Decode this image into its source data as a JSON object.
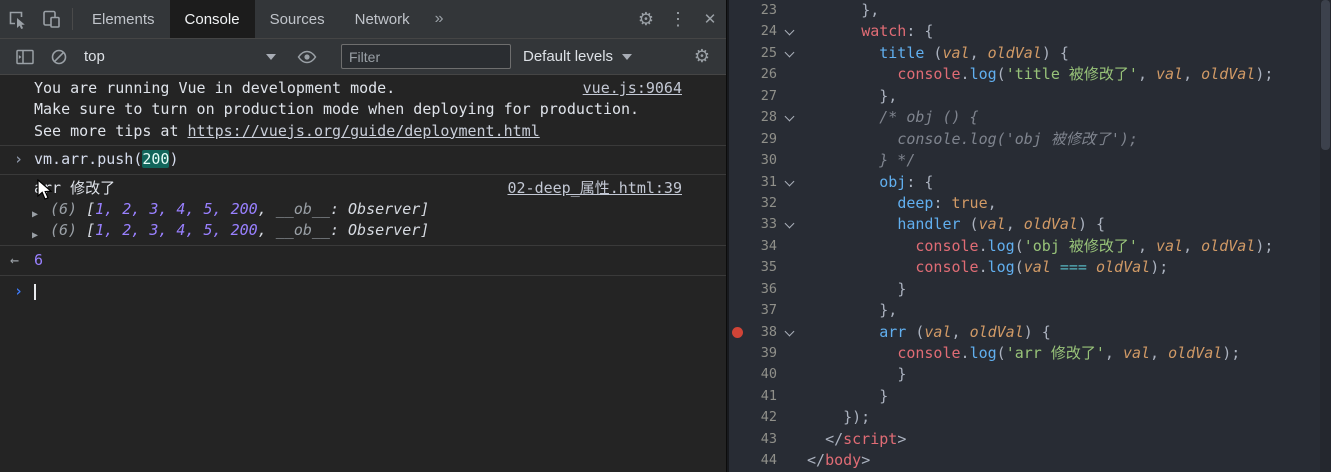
{
  "colors": {
    "toolbar_bg": "#333639",
    "console_bg": "#242424",
    "editor_bg": "#282c34",
    "breakpoint_red": "#d04437",
    "prompt_blue": "#3e7bfa",
    "number_purple": "#9980ff",
    "string_green": "#98c379",
    "func_blue": "#61afef",
    "key_red": "#e06c75",
    "param_orange": "#d19a66",
    "comment_gray": "#7f848e",
    "operator_cyan": "#56b6c2",
    "arg_highlight_teal": "#12655b"
  },
  "devtools": {
    "tabs": [
      "Elements",
      "Console",
      "Sources",
      "Network"
    ],
    "active_tab": "Console",
    "overflow": "»",
    "gear": "⚙",
    "kebab": "⋮",
    "close": "✕"
  },
  "console_toolbar": {
    "context": "top",
    "filter_placeholder": "Filter",
    "levels": "Default levels"
  },
  "console": {
    "vue_message": {
      "line1": "You are running Vue in development mode.",
      "line2": "Make sure to turn on production mode when deploying for production.",
      "line3_prefix": "See more tips at ",
      "line3_link": "https://vuejs.org/guide/deployment.html",
      "source": "vue.js:9064"
    },
    "command": {
      "chevron": "›",
      "prefix": "vm.arr.push(",
      "arg": "200",
      "suffix": ")"
    },
    "log": {
      "text": "arr 修改了",
      "source": "02-deep_属性.html:39",
      "expand_triangle": "▶",
      "array_count": "(6)",
      "array_open": "[",
      "array_numbers": "1, 2, 3, 4, 5, 200",
      "array_sep": ", ",
      "array_key": "__ob__",
      "array_colon": ": ",
      "array_class": "Observer",
      "array_close": "]"
    },
    "result_arrow": "←",
    "result": "6",
    "prompt_chevron": "›"
  },
  "editor": {
    "breakpoint_line": 38,
    "lines": [
      {
        "n": 23,
        "ind": 6,
        "t": [
          [
            "p",
            "},"
          ]
        ]
      },
      {
        "n": 24,
        "ind": 6,
        "fold": true,
        "t": [
          [
            "r",
            "watch"
          ],
          [
            "p",
            ": {"
          ]
        ]
      },
      {
        "n": 25,
        "ind": 8,
        "fold": true,
        "t": [
          [
            "f",
            "title"
          ],
          [
            "p",
            " ("
          ],
          [
            "a",
            "val"
          ],
          [
            "p",
            ", "
          ],
          [
            "a",
            "oldVal"
          ],
          [
            "p",
            ") {"
          ]
        ]
      },
      {
        "n": 26,
        "ind": 10,
        "t": [
          [
            "r",
            "console"
          ],
          [
            "p",
            "."
          ],
          [
            "f",
            "log"
          ],
          [
            "p",
            "("
          ],
          [
            "s",
            "'title 被修改了'"
          ],
          [
            "p",
            ", "
          ],
          [
            "a",
            "val"
          ],
          [
            "p",
            ", "
          ],
          [
            "a",
            "oldVal"
          ],
          [
            "p",
            ");"
          ]
        ]
      },
      {
        "n": 27,
        "ind": 8,
        "t": [
          [
            "p",
            "},"
          ]
        ]
      },
      {
        "n": 28,
        "ind": 8,
        "fold": true,
        "t": [
          [
            "c",
            "/* obj () {"
          ]
        ]
      },
      {
        "n": 29,
        "ind": 10,
        "t": [
          [
            "c",
            "console.log('obj 被修改了');"
          ]
        ]
      },
      {
        "n": 30,
        "ind": 8,
        "t": [
          [
            "c",
            "} */"
          ]
        ]
      },
      {
        "n": 31,
        "ind": 8,
        "fold": true,
        "t": [
          [
            "f",
            "obj"
          ],
          [
            "p",
            ": {"
          ]
        ]
      },
      {
        "n": 32,
        "ind": 10,
        "t": [
          [
            "f",
            "deep"
          ],
          [
            "p",
            ": "
          ],
          [
            "b",
            "true"
          ],
          [
            "p",
            ","
          ]
        ]
      },
      {
        "n": 33,
        "ind": 10,
        "fold": true,
        "t": [
          [
            "f",
            "handler"
          ],
          [
            "p",
            " ("
          ],
          [
            "a",
            "val"
          ],
          [
            "p",
            ", "
          ],
          [
            "a",
            "oldVal"
          ],
          [
            "p",
            ") {"
          ]
        ]
      },
      {
        "n": 34,
        "ind": 12,
        "t": [
          [
            "r",
            "console"
          ],
          [
            "p",
            "."
          ],
          [
            "f",
            "log"
          ],
          [
            "p",
            "("
          ],
          [
            "s",
            "'obj 被修改了'"
          ],
          [
            "p",
            ", "
          ],
          [
            "a",
            "val"
          ],
          [
            "p",
            ", "
          ],
          [
            "a",
            "oldVal"
          ],
          [
            "p",
            ");"
          ]
        ]
      },
      {
        "n": 35,
        "ind": 12,
        "t": [
          [
            "r",
            "console"
          ],
          [
            "p",
            "."
          ],
          [
            "f",
            "log"
          ],
          [
            "p",
            "("
          ],
          [
            "a",
            "val"
          ],
          [
            "p",
            " "
          ],
          [
            "o",
            "==="
          ],
          [
            "p",
            " "
          ],
          [
            "a",
            "oldVal"
          ],
          [
            "p",
            ");"
          ]
        ]
      },
      {
        "n": 36,
        "ind": 10,
        "t": [
          [
            "p",
            "}"
          ]
        ]
      },
      {
        "n": 37,
        "ind": 8,
        "t": [
          [
            "p",
            "},"
          ]
        ]
      },
      {
        "n": 38,
        "ind": 8,
        "fold": true,
        "bp": true,
        "t": [
          [
            "f",
            "arr"
          ],
          [
            "p",
            " ("
          ],
          [
            "a",
            "val"
          ],
          [
            "p",
            ", "
          ],
          [
            "a",
            "oldVal"
          ],
          [
            "p",
            ") {"
          ]
        ]
      },
      {
        "n": 39,
        "ind": 10,
        "t": [
          [
            "r",
            "console"
          ],
          [
            "p",
            "."
          ],
          [
            "f",
            "log"
          ],
          [
            "p",
            "("
          ],
          [
            "s",
            "'arr 修改了'"
          ],
          [
            "p",
            ", "
          ],
          [
            "a",
            "val"
          ],
          [
            "p",
            ", "
          ],
          [
            "a",
            "oldVal"
          ],
          [
            "p",
            ");"
          ]
        ]
      },
      {
        "n": 40,
        "ind": 10,
        "t": [
          [
            "p",
            "}"
          ]
        ]
      },
      {
        "n": 41,
        "ind": 8,
        "t": [
          [
            "p",
            "}"
          ]
        ]
      },
      {
        "n": 42,
        "ind": 4,
        "t": [
          [
            "p",
            "});"
          ]
        ]
      },
      {
        "n": 43,
        "ind": 2,
        "t": [
          [
            "p",
            "</"
          ],
          [
            "t2",
            "script"
          ],
          [
            "p",
            ">"
          ]
        ]
      },
      {
        "n": 44,
        "ind": 0,
        "t": [
          [
            "p",
            "</"
          ],
          [
            "t2",
            "body"
          ],
          [
            "p",
            ">"
          ]
        ]
      }
    ]
  }
}
